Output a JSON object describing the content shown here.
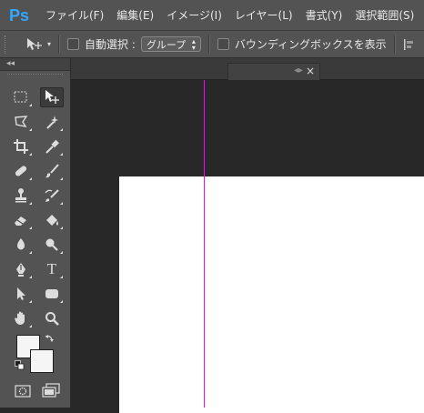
{
  "app": {
    "logo": "Ps",
    "logo_color": "#31a8ff"
  },
  "menu": [
    {
      "label": "ファイル(F)"
    },
    {
      "label": "編集(E)"
    },
    {
      "label": "イメージ(I)"
    },
    {
      "label": "レイヤー(L)"
    },
    {
      "label": "書式(Y)"
    },
    {
      "label": "選択範囲(S)"
    }
  ],
  "options": {
    "tool_icon": "move-tool-icon",
    "auto_select_label": "自動選択 :",
    "auto_select_checked": false,
    "auto_select_value": "グループ",
    "transform_controls_label": "バウンディングボックスを表示",
    "transform_controls_checked": false
  },
  "toolbox": {
    "collapse_glyph": "◂◂",
    "tools": [
      {
        "name": "rectangular-marquee-tool",
        "icon": "marquee-icon"
      },
      {
        "name": "move-tool",
        "icon": "move-icon",
        "active": true
      },
      {
        "name": "lasso-tool",
        "icon": "lasso-icon"
      },
      {
        "name": "magic-wand-tool",
        "icon": "magic-wand-icon"
      },
      {
        "name": "crop-tool",
        "icon": "crop-icon"
      },
      {
        "name": "eyedropper-tool",
        "icon": "eyedropper-icon"
      },
      {
        "name": "spot-healing-brush-tool",
        "icon": "bandage-icon"
      },
      {
        "name": "brush-tool",
        "icon": "brush-icon"
      },
      {
        "name": "clone-stamp-tool",
        "icon": "stamp-icon"
      },
      {
        "name": "history-brush-tool",
        "icon": "history-brush-icon"
      },
      {
        "name": "eraser-tool",
        "icon": "eraser-icon"
      },
      {
        "name": "paint-bucket-tool",
        "icon": "bucket-icon"
      },
      {
        "name": "blur-tool",
        "icon": "blur-icon"
      },
      {
        "name": "dodge-tool",
        "icon": "dodge-icon"
      },
      {
        "name": "pen-tool",
        "icon": "pen-icon"
      },
      {
        "name": "type-tool",
        "icon": "type-icon",
        "glyph": "T"
      },
      {
        "name": "path-selection-tool",
        "icon": "arrow-icon"
      },
      {
        "name": "rectangle-tool",
        "icon": "rounded-rect-icon"
      },
      {
        "name": "hand-tool",
        "icon": "hand-icon"
      },
      {
        "name": "zoom-tool",
        "icon": "zoom-icon"
      }
    ],
    "foreground_color": "#f5f5f5",
    "background_color": "#f5f5f5"
  },
  "document_tab": {
    "close_glyph": "×",
    "mark_glyph": "◂▸"
  },
  "canvas": {
    "guide_color": "#ff00ff"
  }
}
